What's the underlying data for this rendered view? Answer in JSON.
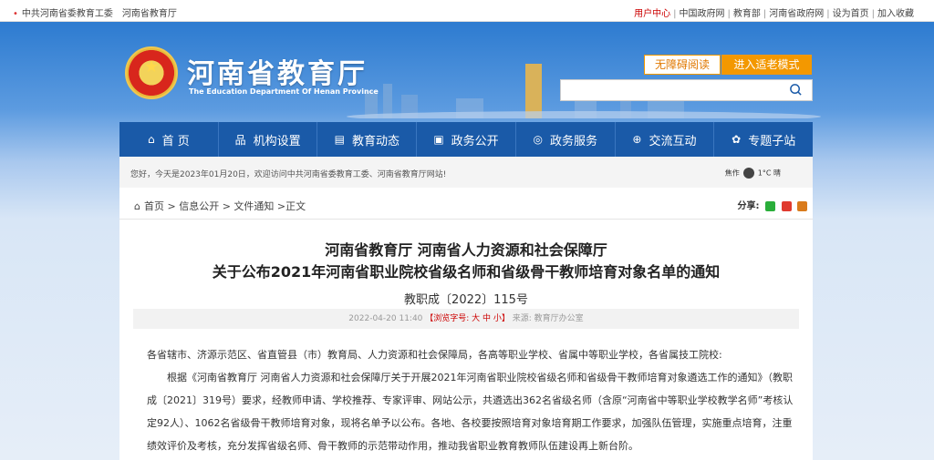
{
  "topbar": {
    "left_links": [
      "中共河南省委教育工委",
      "河南省教育厅"
    ],
    "right_links": {
      "user_center": "用户中心",
      "gov": "中国政府网",
      "moe": "教育部",
      "henan_gov": "河南省政府网",
      "homepage": "设为首页",
      "favorite": "加入收藏"
    }
  },
  "header": {
    "site_name": "河南省教育厅",
    "site_name_en": "The Education Department Of Henan Province",
    "accessibility_btn": "无障碍阅读",
    "elder_mode_btn": "进入适老模式",
    "search_placeholder": ""
  },
  "nav": {
    "items": [
      {
        "label": "首 页",
        "icon": "⌂"
      },
      {
        "label": "机构设置",
        "icon": "品"
      },
      {
        "label": "教育动态",
        "icon": "▤"
      },
      {
        "label": "政务公开",
        "icon": "▣"
      },
      {
        "label": "政务服务",
        "icon": "◎"
      },
      {
        "label": "交流互动",
        "icon": "⊕"
      },
      {
        "label": "专题子站",
        "icon": "✿"
      }
    ]
  },
  "welcome": {
    "text": "您好，今天是2023年01月20日，欢迎访问中共河南省委教育工委、河南省教育厅网站!",
    "city": "焦作",
    "temp": "1°C 晴"
  },
  "breadcrumb": {
    "home": "首页",
    "level2": "信息公开",
    "level3": "文件通知",
    "current": "正文"
  },
  "share": {
    "label": "分享:"
  },
  "article": {
    "title_line1": "河南省教育厅 河南省人力资源和社会保障厅",
    "title_line2": "关于公布2021年河南省职业院校省级名师和省级骨干教师培育对象名单的通知",
    "doc_no": "教职成〔2022〕115号",
    "date": "2022-04-20 11:40",
    "font_size_label": "【浏览字号: 大 中 小】",
    "source": "来源: 教育厅办公室",
    "salutation": "各省辖市、济源示范区、省直管县（市）教育局、人力资源和社会保障局，各高等职业学校、省属中等职业学校，各省属技工院校:",
    "para1": "根据《河南省教育厅 河南省人力资源和社会保障厅关于开展2021年河南省职业院校省级名师和省级骨干教师培育对象遴选工作的通知》（教职成〔2021〕319号）要求，经教师申请、学校推荐、专家评审、网站公示，共遴选出362名省级名师（含原“河南省中等职业学校教学名师”考核认定92人）、1062名省级骨干教师培育对象，现将名单予以公布。各地、各校要按照培育对象培育期工作要求，加强队伍管理，实施重点培育，注重绩效评价及考核，充分发挥省级名师、骨干教师的示范带动作用，推动我省职业教育教师队伍建设再上新台阶。"
  },
  "colors": {
    "nav_bg": "#1a5aa8",
    "accent_orange": "#f39800",
    "link_red": "#c00000"
  }
}
